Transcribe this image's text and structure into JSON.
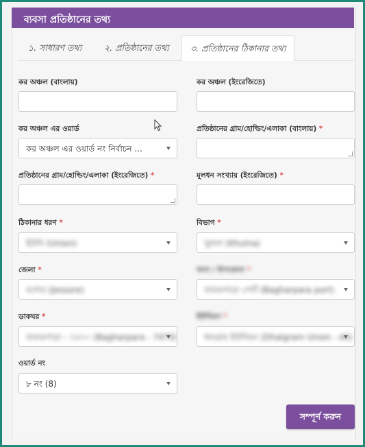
{
  "header": {
    "title": "ব্যবসা প্রতিষ্ঠানের তথ্য"
  },
  "tabs": [
    {
      "label": "১. সাধারণ তথ্য"
    },
    {
      "label": "২. প্রতিষ্ঠানের তথ্য"
    },
    {
      "label": "৩. প্রতিষ্ঠানের ঠিকানার তথ্য"
    }
  ],
  "fields": {
    "tax_zone_bn": {
      "label": "কর অঞ্চল (বাংলায়)"
    },
    "tax_zone_en": {
      "label": "কর অঞ্চল (ইংরেজিতে)"
    },
    "tax_ward": {
      "label": "কর অঞ্চল এর ওয়ার্ড",
      "value": "কর অঞ্চল এর ওয়ার্ড নং নির্বাচন ..."
    },
    "village_bn": {
      "label": "প্রতিষ্ঠানের গ্রাম/হোল্ডিং/এলাকা (বাংলায়)",
      "required": "*"
    },
    "village_en": {
      "label": "প্রতিষ্ঠানের গ্রাম/হোল্ডিং/এলাকা (ইংরেজিতে)",
      "required": "*"
    },
    "capital": {
      "label": "মূলধন সংখ্যায় (ইংরেজিতে)",
      "required": "*"
    },
    "address_type": {
      "label": "ঠিকানার ধরণ",
      "required": "*",
      "value": "ইউনি (Union)"
    },
    "division": {
      "label": "বিভাগ",
      "required": "*",
      "value": "খুলনা (Khulna)"
    },
    "district": {
      "label": "জেলা",
      "required": "*",
      "value": "যশোর (Jessore)"
    },
    "upazila": {
      "label": "থানা / উপজেলা",
      "required": "*",
      "value": "বাঘারপাড়া পোর্ট (Bagharpara port)"
    },
    "post_office": {
      "label": "ডাকঘর",
      "required": "*",
      "value": "বাঘারপাড়া - ৭৪৭০ (Bagharpara - 7470)"
    },
    "union": {
      "label": "ইউনিয়ন",
      "required": "*",
      "value": "ধলগ্রাম ইউনিয়ন (Dhalgram Union - Ali)"
    },
    "ward_no": {
      "label": "ওয়ার্ড নং",
      "value": "৮ নং (8)"
    }
  },
  "submit": {
    "label": "সম্পূর্ণ করুন"
  },
  "colors": {
    "accent": "#7b4f9d",
    "frame": "#1f8a78",
    "required": "#d9534f"
  }
}
